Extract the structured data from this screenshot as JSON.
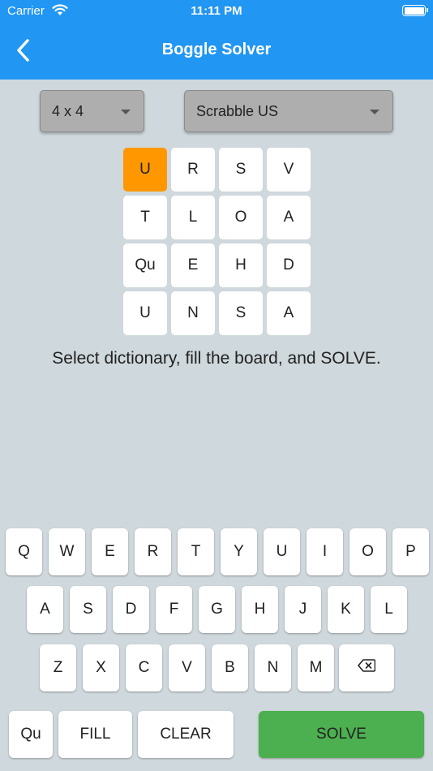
{
  "status_bar": {
    "carrier": "Carrier",
    "time": "11:11 PM"
  },
  "app_bar": {
    "title": "Boggle Solver",
    "back_icon": "chevron-left-icon"
  },
  "controls": {
    "board_size": "4 x 4",
    "dictionary": "Scrabble US"
  },
  "board": {
    "selected_index": 0,
    "accent_color": "#ff9800",
    "cells": [
      "U",
      "R",
      "S",
      "V",
      "T",
      "L",
      "O",
      "A",
      "Qu",
      "E",
      "H",
      "D",
      "U",
      "N",
      "S",
      "A"
    ]
  },
  "hint": "Select dictionary, fill the board, and SOLVE.",
  "keyboard": {
    "row1": [
      "Q",
      "W",
      "E",
      "R",
      "T",
      "Y",
      "U",
      "I",
      "O",
      "P"
    ],
    "row2": [
      "A",
      "S",
      "D",
      "F",
      "G",
      "H",
      "J",
      "K",
      "L"
    ],
    "row3": [
      "Z",
      "X",
      "C",
      "V",
      "B",
      "N",
      "M"
    ],
    "backspace_icon": "backspace-icon",
    "qu": "Qu",
    "fill": "FILL",
    "clear": "CLEAR",
    "solve": "SOLVE",
    "solve_color": "#4caf50"
  }
}
